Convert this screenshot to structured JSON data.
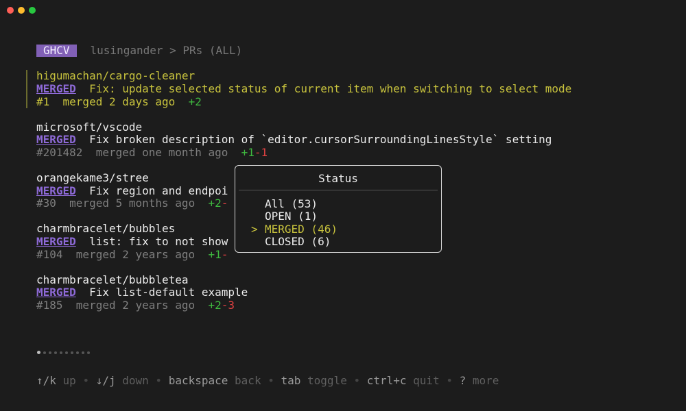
{
  "window": {
    "controls": [
      "close",
      "minimize",
      "maximize"
    ],
    "control_colors": [
      "#ff5f57",
      "#febc2e",
      "#28c840"
    ]
  },
  "header": {
    "badge": "GHCV",
    "breadcrumb": "lusingander > PRs (ALL)"
  },
  "prs": [
    {
      "repo": "higumachan/cargo-cleaner",
      "status": "MERGED",
      "title": "Fix: update selected status of current item when switching to select mode",
      "number": "#1",
      "merged": "merged 2 days ago",
      "additions": "+2",
      "deletions": ""
    },
    {
      "repo": "microsoft/vscode",
      "status": "MERGED",
      "title": "Fix broken description of `editor.cursorSurroundingLinesStyle` setting",
      "number": "#201482",
      "merged": "merged one month ago",
      "additions": "+1",
      "deletions": "-1"
    },
    {
      "repo": "orangekame3/stree",
      "status": "MERGED",
      "title": "Fix region and endpoi",
      "number": "#30",
      "merged": "merged 5 months ago",
      "additions": "+2",
      "deletions": "-"
    },
    {
      "repo": "charmbracelet/bubbles",
      "status": "MERGED",
      "title": "list: fix to not show",
      "number": "#104",
      "merged": "merged 2 years ago",
      "additions": "+1",
      "deletions": "-"
    },
    {
      "repo": "charmbracelet/bubbletea",
      "status": "MERGED",
      "title": "Fix list-default example",
      "number": "#185",
      "merged": "merged 2 years ago",
      "additions": "+2",
      "deletions": "-3"
    }
  ],
  "status_popup": {
    "title": "Status",
    "cursor": ">",
    "options": [
      "All (53)",
      "OPEN (1)",
      "MERGED (46)",
      "CLOSED (6)"
    ],
    "selected": "MERGED (46)"
  },
  "pager": {
    "pages": 10,
    "current": 1
  },
  "help": [
    {
      "key": "↑/k",
      "action": "up"
    },
    {
      "key": "↓/j",
      "action": "down"
    },
    {
      "key": "backspace",
      "action": "back"
    },
    {
      "key": "tab",
      "action": "toggle"
    },
    {
      "key": "ctrl+c",
      "action": "quit"
    },
    {
      "key": "?",
      "action": "more"
    }
  ],
  "help_separator": "•"
}
